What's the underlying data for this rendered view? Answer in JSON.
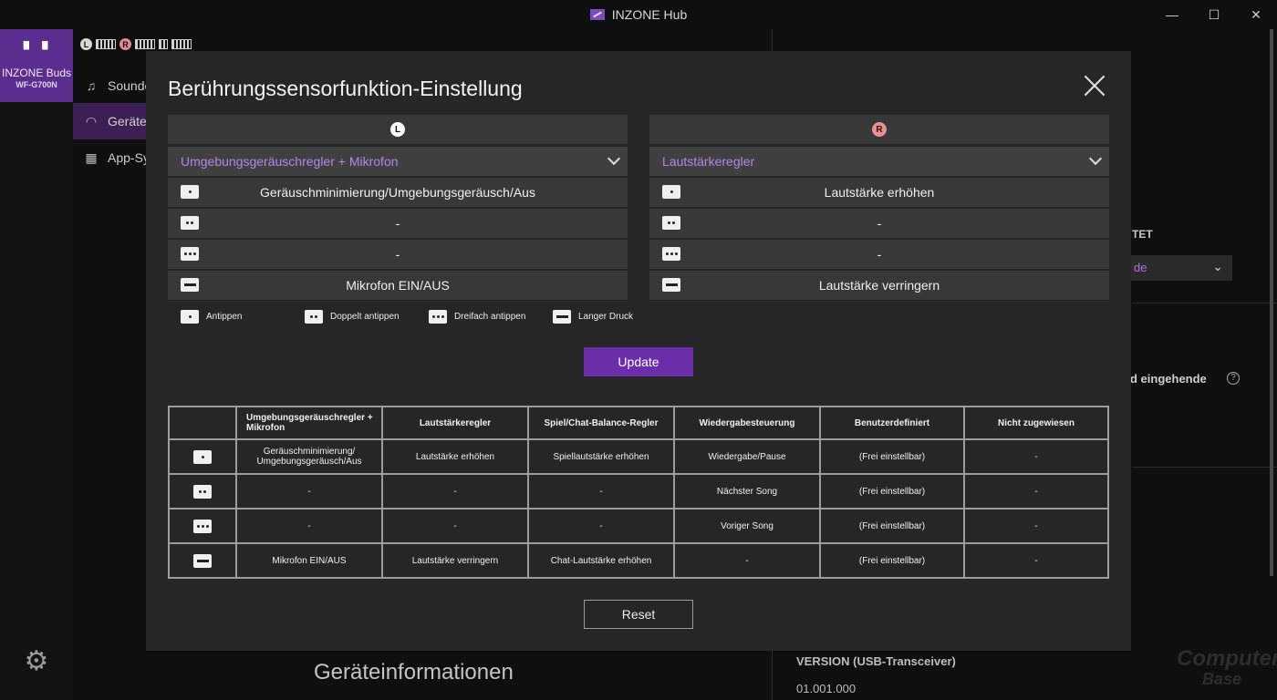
{
  "app": {
    "title": "INZONE Hub"
  },
  "window_controls": {
    "minimize": "—",
    "maximize": "☐",
    "close": "✕"
  },
  "device": {
    "name": "INZONE Buds",
    "model": "WF-G700N"
  },
  "status": {
    "left_badge": "L",
    "right_badge": "R"
  },
  "side_menu": [
    {
      "label": "Sounde",
      "icon": "♫"
    },
    {
      "label": "Geräte",
      "icon": "🎧"
    },
    {
      "label": "App-Sy",
      "icon": "▦"
    }
  ],
  "background": {
    "section_title": "Geräteinformationen",
    "tet_label": "TET",
    "dropdown_value": "de",
    "incoming_label": "d eingehende",
    "help": "?",
    "version_label": "VERSION (USB-Transceiver)",
    "version_value": "01.001.000",
    "watermark_top": "Computer",
    "watermark_bottom": "Base"
  },
  "dialog": {
    "title": "Berührungssensorfunktion-Einstellung",
    "left": {
      "badge": "L",
      "selected_function": "Umgebungsgeräuschregler + Mikrofon",
      "rows": [
        "Geräuschminimierung/Umgebungsgeräusch/Aus",
        "-",
        "-",
        "Mikrofon EIN/AUS"
      ]
    },
    "right": {
      "badge": "R",
      "selected_function": "Lautstärkeregler",
      "rows": [
        "Lautstärke erhöhen",
        "-",
        "-",
        "Lautstärke verringern"
      ]
    },
    "legend": {
      "tap": "Antippen",
      "double_tap": "Doppelt antippen",
      "triple_tap": "Dreifach antippen",
      "long_press": "Langer Druck"
    },
    "update_label": "Update",
    "reset_label": "Reset",
    "table": {
      "headers": [
        "Umgebungsgeräuschregler + Mikrofon",
        "Lautstärkeregler",
        "Spiel/Chat-Balance-Regler",
        "Wiedergabesteuerung",
        "Benutzerdefiniert",
        "Nicht zugewiesen"
      ],
      "rows": [
        [
          "Geräuschminimierung/ Umgebungsgeräusch/Aus",
          "Lautstärke erhöhen",
          "Spiellautstärke erhöhen",
          "Wiedergabe/Pause",
          "(Frei einstellbar)",
          "-"
        ],
        [
          "-",
          "-",
          "-",
          "Nächster Song",
          "(Frei einstellbar)",
          "-"
        ],
        [
          "-",
          "-",
          "-",
          "Voriger Song",
          "(Frei einstellbar)",
          "-"
        ],
        [
          "Mikrofon EIN/AUS",
          "Lautstärke verringern",
          "Chat-Lautstärke erhöhen",
          "-",
          "(Frei einstellbar)",
          "-"
        ]
      ]
    }
  }
}
